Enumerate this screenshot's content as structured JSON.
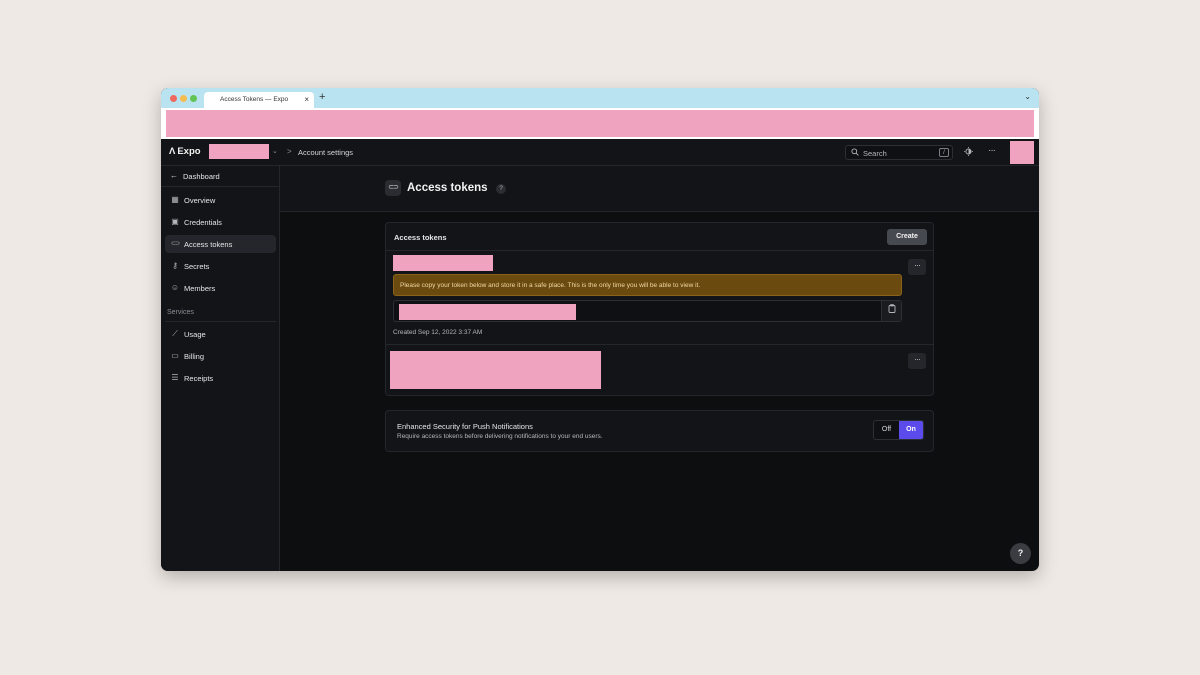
{
  "browser": {
    "tab_title": "Access Tokens — Expo",
    "tab_close": "×",
    "new_tab": "+",
    "tab_menu": "⌄"
  },
  "appbar": {
    "logo": "Expo",
    "logo_mark": "Λ",
    "account_chevron": "⌄",
    "crumb_separator": ">",
    "crumb": "Account settings",
    "search_label": "Search",
    "search_shortcut": "/",
    "theme_icon": "theme-icon",
    "more_icon": "more-icon"
  },
  "sidebar": {
    "back_label": "Dashboard",
    "items": [
      {
        "label": "Overview",
        "icon": "grid-icon",
        "glyph": "▦"
      },
      {
        "label": "Credentials",
        "icon": "id-card-icon",
        "glyph": "▣"
      },
      {
        "label": "Access tokens",
        "icon": "token-icon",
        "glyph": "⊂⊃",
        "active": true
      },
      {
        "label": "Secrets",
        "icon": "key-icon",
        "glyph": "⚷"
      },
      {
        "label": "Members",
        "icon": "members-icon",
        "glyph": "☺"
      }
    ],
    "section_label": "Services",
    "service_items": [
      {
        "label": "Usage",
        "icon": "chart-icon",
        "glyph": "⟋"
      },
      {
        "label": "Billing",
        "icon": "billing-icon",
        "glyph": "▭"
      },
      {
        "label": "Receipts",
        "icon": "receipt-icon",
        "glyph": "☰"
      }
    ]
  },
  "main": {
    "title": "Access tokens",
    "title_icon": "⊂⊃",
    "help": "?",
    "tokens_card": {
      "title": "Access tokens",
      "create_label": "Create",
      "menu": "···",
      "warning": "Please copy your token below and store it in a safe place. This is the only time you will be able to view it.",
      "copy_icon": "▯",
      "created": "Created Sep 12, 2022 3:37 AM"
    },
    "push_card": {
      "title": "Enhanced Security for Push Notifications",
      "description": "Require access tokens before delivering notifications to your end users.",
      "off_label": "Off",
      "on_label": "On",
      "selected": "On"
    },
    "help_fab": "?"
  },
  "colors": {
    "accent": "#5b4bea",
    "warning_bg": "#6b4a0f",
    "redaction": "#f0a3bf"
  }
}
